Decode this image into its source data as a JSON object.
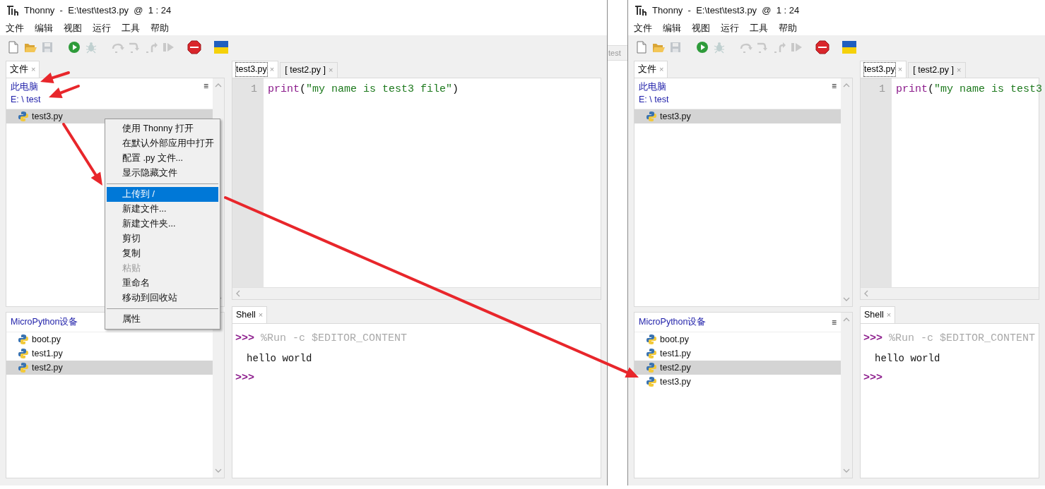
{
  "windows": [
    {
      "title": "Thonny  -  E:\\test\\test3.py  @  1 : 24",
      "menu": [
        "文件",
        "编辑",
        "视图",
        "运行",
        "工具",
        "帮助"
      ],
      "toolbar": [
        {
          "kind": "new",
          "disabled": false
        },
        {
          "kind": "open",
          "disabled": false
        },
        {
          "kind": "save",
          "disabled": true
        },
        {
          "kind": "run",
          "disabled": false
        },
        {
          "kind": "debug",
          "disabled": true
        },
        {
          "kind": "step-over",
          "disabled": true
        },
        {
          "kind": "step-into",
          "disabled": true
        },
        {
          "kind": "step-out",
          "disabled": true
        },
        {
          "kind": "resume",
          "disabled": true
        },
        {
          "kind": "stop",
          "disabled": false
        },
        {
          "kind": "flag",
          "disabled": false
        }
      ],
      "files_tab": {
        "label": "文件",
        "close": "×"
      },
      "computer": {
        "heading": "此电脑",
        "path": "E: \\ test",
        "menu_glyph": "≡",
        "files": [
          {
            "name": "test3.py",
            "selected": true
          }
        ]
      },
      "device": {
        "heading": "MicroPython设备",
        "files": [
          {
            "name": "boot.py",
            "selected": false
          },
          {
            "name": "test1.py",
            "selected": false
          },
          {
            "name": "test2.py",
            "selected": true
          }
        ]
      },
      "editor_tabs": [
        {
          "label": "test3.py",
          "close": "×",
          "selected": true
        },
        {
          "label": "[ test2.py ]",
          "close": "×",
          "selected": false
        }
      ],
      "editor": {
        "line_numbers": [
          "1"
        ],
        "lines": [
          [
            {
              "kind": "builtin",
              "text": "print"
            },
            {
              "kind": "plain",
              "text": "("
            },
            {
              "kind": "string",
              "text": "\"my name is test3 file\""
            },
            {
              "kind": "plain",
              "text": ")"
            }
          ]
        ]
      },
      "shell": {
        "tab": "Shell",
        "close": "×",
        "lines": [
          {
            "kind": "input",
            "prompt": ">>>",
            "command": "%Run -c $EDITOR_CONTENT"
          },
          {
            "kind": "output",
            "text": "hello world"
          },
          {
            "kind": "input",
            "prompt": ">>>"
          }
        ]
      }
    },
    {
      "title": "Thonny  -  E:\\test\\test3.py  @  1 : 24",
      "menu": [
        "文件",
        "编辑",
        "视图",
        "运行",
        "工具",
        "帮助"
      ],
      "toolbar": [
        {
          "kind": "new",
          "disabled": false
        },
        {
          "kind": "open",
          "disabled": false
        },
        {
          "kind": "save",
          "disabled": true
        },
        {
          "kind": "run",
          "disabled": false
        },
        {
          "kind": "debug",
          "disabled": true
        },
        {
          "kind": "step-over",
          "disabled": true
        },
        {
          "kind": "step-into",
          "disabled": true
        },
        {
          "kind": "step-out",
          "disabled": true
        },
        {
          "kind": "resume",
          "disabled": true
        },
        {
          "kind": "stop",
          "disabled": false
        },
        {
          "kind": "flag",
          "disabled": false
        }
      ],
      "files_tab": {
        "label": "文件",
        "close": "×"
      },
      "computer": {
        "heading": "此电脑",
        "path": "E: \\ test",
        "menu_glyph": "≡",
        "files": [
          {
            "name": "test3.py",
            "selected": true
          }
        ]
      },
      "device": {
        "heading": "MicroPython设备",
        "menu_glyph": "≡",
        "files": [
          {
            "name": "boot.py",
            "selected": false
          },
          {
            "name": "test1.py",
            "selected": false
          },
          {
            "name": "test2.py",
            "selected": true
          },
          {
            "name": "test3.py",
            "selected": false
          }
        ]
      },
      "editor_tabs": [
        {
          "label": "test3.py",
          "close": "×",
          "selected": true
        },
        {
          "label": "[ test2.py ]",
          "close": "×",
          "selected": false
        }
      ],
      "editor": {
        "line_numbers": [
          "1"
        ],
        "lines": [
          [
            {
              "kind": "builtin",
              "text": "print"
            },
            {
              "kind": "plain",
              "text": "("
            },
            {
              "kind": "string",
              "text": "\"my name is test3"
            }
          ]
        ]
      },
      "shell": {
        "tab": "Shell",
        "close": "×",
        "lines": [
          {
            "kind": "input",
            "prompt": ">>>",
            "command": "%Run -c $EDITOR_CONTENT"
          },
          {
            "kind": "output",
            "text": "hello world"
          },
          {
            "kind": "input",
            "prompt": ">>>"
          }
        ]
      }
    }
  ],
  "background_window": {
    "text": "test"
  },
  "context_menu": {
    "items": [
      {
        "kind": "item",
        "label": "使用 Thonny 打开",
        "selected": false,
        "disabled": false
      },
      {
        "kind": "item",
        "label": "在默认外部应用中打开",
        "selected": false,
        "disabled": false
      },
      {
        "kind": "item",
        "label": "配置 .py 文件...",
        "selected": false,
        "disabled": false
      },
      {
        "kind": "item",
        "label": "显示隐藏文件",
        "selected": false,
        "disabled": false
      },
      {
        "kind": "separator"
      },
      {
        "kind": "item",
        "label": "上传到 /",
        "selected": true,
        "disabled": false
      },
      {
        "kind": "item",
        "label": "新建文件...",
        "selected": false,
        "disabled": false
      },
      {
        "kind": "item",
        "label": "新建文件夹...",
        "selected": false,
        "disabled": false
      },
      {
        "kind": "item",
        "label": "剪切",
        "selected": false,
        "disabled": false
      },
      {
        "kind": "item",
        "label": "复制",
        "selected": false,
        "disabled": false
      },
      {
        "kind": "item",
        "label": "粘贴",
        "selected": false,
        "disabled": true
      },
      {
        "kind": "item",
        "label": "重命名",
        "selected": false,
        "disabled": false
      },
      {
        "kind": "item",
        "label": "移动到回收站",
        "selected": false,
        "disabled": false
      },
      {
        "kind": "separator"
      },
      {
        "kind": "item",
        "label": "属性",
        "selected": false,
        "disabled": false
      }
    ]
  }
}
